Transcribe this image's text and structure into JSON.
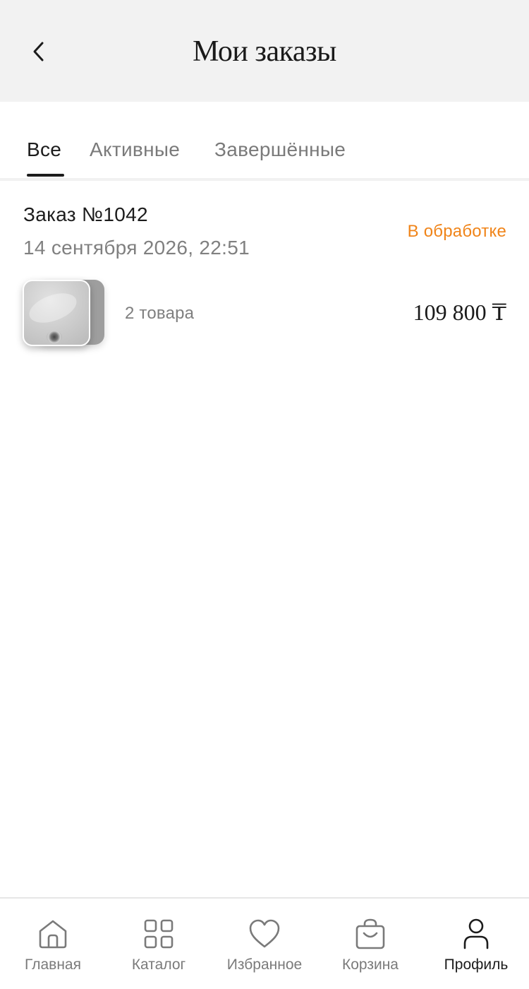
{
  "header": {
    "title": "Мои заказы",
    "back_icon": "chevron-left-icon"
  },
  "tabs": [
    {
      "label": "Все",
      "active": true
    },
    {
      "label": "Активные",
      "active": false
    },
    {
      "label": "Завершённые",
      "active": false
    }
  ],
  "orders": [
    {
      "number": "Заказ №1042",
      "date": "14 сентября 2026, 22:51",
      "status": "В обработке",
      "items_count": "2 товара",
      "total": "109 800 ₸"
    }
  ],
  "bottom_nav": [
    {
      "label": "Главная",
      "icon": "home-icon",
      "active": false
    },
    {
      "label": "Каталог",
      "icon": "grid-icon",
      "active": false
    },
    {
      "label": "Избранное",
      "icon": "heart-icon",
      "active": false
    },
    {
      "label": "Корзина",
      "icon": "bag-icon",
      "active": false
    },
    {
      "label": "Профиль",
      "icon": "user-icon",
      "active": true
    }
  ],
  "colors": {
    "accent_status": "#f08419",
    "header_bg": "#f2f2f2",
    "text_primary": "#1c1c1c",
    "text_secondary": "#808080"
  }
}
